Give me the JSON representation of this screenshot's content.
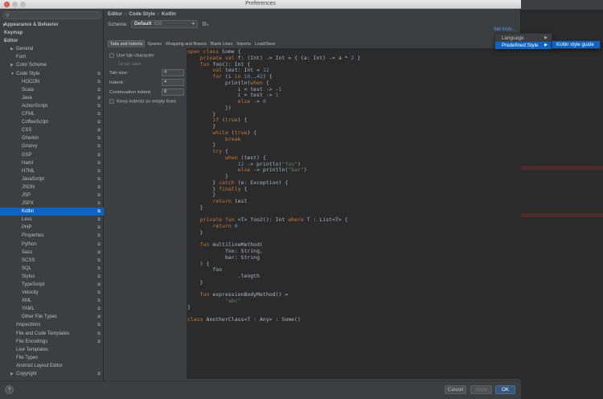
{
  "window": {
    "title": "Preferences"
  },
  "sidebar": {
    "items": [
      {
        "label": "Appearance & Behavior",
        "level": 0,
        "expand": "right",
        "bold": true,
        "copy": false,
        "selected": false
      },
      {
        "label": "Keymap",
        "level": 0,
        "expand": "",
        "bold": true,
        "copy": false,
        "selected": false
      },
      {
        "label": "Editor",
        "level": 0,
        "expand": "down",
        "bold": true,
        "copy": false,
        "selected": false
      },
      {
        "label": "General",
        "level": 1,
        "expand": "right",
        "bold": false,
        "copy": false,
        "selected": false
      },
      {
        "label": "Font",
        "level": 1,
        "expand": "",
        "bold": false,
        "copy": false,
        "selected": false
      },
      {
        "label": "Color Scheme",
        "level": 1,
        "expand": "right",
        "bold": false,
        "copy": false,
        "selected": false
      },
      {
        "label": "Code Style",
        "level": 1,
        "expand": "down",
        "bold": false,
        "copy": true,
        "selected": false
      },
      {
        "label": "HOCON",
        "level": 2,
        "expand": "",
        "bold": false,
        "copy": true,
        "selected": false
      },
      {
        "label": "Scala",
        "level": 2,
        "expand": "",
        "bold": false,
        "copy": true,
        "selected": false
      },
      {
        "label": "Java",
        "level": 2,
        "expand": "",
        "bold": false,
        "copy": true,
        "selected": false
      },
      {
        "label": "ActionScript",
        "level": 2,
        "expand": "",
        "bold": false,
        "copy": true,
        "selected": false
      },
      {
        "label": "CFML",
        "level": 2,
        "expand": "",
        "bold": false,
        "copy": true,
        "selected": false
      },
      {
        "label": "CoffeeScript",
        "level": 2,
        "expand": "",
        "bold": false,
        "copy": true,
        "selected": false
      },
      {
        "label": "CSS",
        "level": 2,
        "expand": "",
        "bold": false,
        "copy": true,
        "selected": false
      },
      {
        "label": "Gherkin",
        "level": 2,
        "expand": "",
        "bold": false,
        "copy": true,
        "selected": false
      },
      {
        "label": "Groovy",
        "level": 2,
        "expand": "",
        "bold": false,
        "copy": true,
        "selected": false
      },
      {
        "label": "GSP",
        "level": 2,
        "expand": "",
        "bold": false,
        "copy": true,
        "selected": false
      },
      {
        "label": "Haml",
        "level": 2,
        "expand": "",
        "bold": false,
        "copy": true,
        "selected": false
      },
      {
        "label": "HTML",
        "level": 2,
        "expand": "",
        "bold": false,
        "copy": true,
        "selected": false
      },
      {
        "label": "JavaScript",
        "level": 2,
        "expand": "",
        "bold": false,
        "copy": true,
        "selected": false
      },
      {
        "label": "JSON",
        "level": 2,
        "expand": "",
        "bold": false,
        "copy": true,
        "selected": false
      },
      {
        "label": "JSP",
        "level": 2,
        "expand": "",
        "bold": false,
        "copy": true,
        "selected": false
      },
      {
        "label": "JSPX",
        "level": 2,
        "expand": "",
        "bold": false,
        "copy": true,
        "selected": false
      },
      {
        "label": "Kotlin",
        "level": 2,
        "expand": "",
        "bold": false,
        "copy": true,
        "selected": true
      },
      {
        "label": "Less",
        "level": 2,
        "expand": "",
        "bold": false,
        "copy": true,
        "selected": false
      },
      {
        "label": "PHP",
        "level": 2,
        "expand": "",
        "bold": false,
        "copy": true,
        "selected": false
      },
      {
        "label": "Properties",
        "level": 2,
        "expand": "",
        "bold": false,
        "copy": true,
        "selected": false
      },
      {
        "label": "Python",
        "level": 2,
        "expand": "",
        "bold": false,
        "copy": true,
        "selected": false
      },
      {
        "label": "Sass",
        "level": 2,
        "expand": "",
        "bold": false,
        "copy": true,
        "selected": false
      },
      {
        "label": "SCSS",
        "level": 2,
        "expand": "",
        "bold": false,
        "copy": true,
        "selected": false
      },
      {
        "label": "SQL",
        "level": 2,
        "expand": "",
        "bold": false,
        "copy": true,
        "selected": false
      },
      {
        "label": "Stylus",
        "level": 2,
        "expand": "",
        "bold": false,
        "copy": true,
        "selected": false
      },
      {
        "label": "TypeScript",
        "level": 2,
        "expand": "",
        "bold": false,
        "copy": true,
        "selected": false
      },
      {
        "label": "Velocity",
        "level": 2,
        "expand": "",
        "bold": false,
        "copy": true,
        "selected": false
      },
      {
        "label": "XML",
        "level": 2,
        "expand": "",
        "bold": false,
        "copy": true,
        "selected": false
      },
      {
        "label": "YAML",
        "level": 2,
        "expand": "",
        "bold": false,
        "copy": true,
        "selected": false
      },
      {
        "label": "Other File Types",
        "level": 2,
        "expand": "",
        "bold": false,
        "copy": true,
        "selected": false
      },
      {
        "label": "Inspections",
        "level": 1,
        "expand": "",
        "bold": false,
        "copy": true,
        "selected": false
      },
      {
        "label": "File and Code Templates",
        "level": 1,
        "expand": "",
        "bold": false,
        "copy": true,
        "selected": false
      },
      {
        "label": "File Encodings",
        "level": 1,
        "expand": "",
        "bold": false,
        "copy": true,
        "selected": false
      },
      {
        "label": "Live Templates",
        "level": 1,
        "expand": "",
        "bold": false,
        "copy": false,
        "selected": false
      },
      {
        "label": "File Types",
        "level": 1,
        "expand": "",
        "bold": false,
        "copy": false,
        "selected": false
      },
      {
        "label": "Android Layout Editor",
        "level": 1,
        "expand": "",
        "bold": false,
        "copy": false,
        "selected": false
      },
      {
        "label": "Copyright",
        "level": 1,
        "expand": "right",
        "bold": false,
        "copy": true,
        "selected": false
      }
    ]
  },
  "breadcrumb": [
    "Editor",
    "Code Style",
    "Kotlin"
  ],
  "scheme": {
    "label": "Scheme:",
    "value": "Default",
    "suffix": "IDE"
  },
  "set_from": "Set from...",
  "tabs": [
    "Tabs and Indents",
    "Spaces",
    "Wrapping and Braces",
    "Blank Lines",
    "Imports",
    "Load/Save"
  ],
  "active_tab": 0,
  "options": {
    "use_tab": "Use tab character",
    "smart_tabs": "Smart tabs",
    "tab_size_label": "Tab size:",
    "tab_size": "4",
    "indent_label": "Indent:",
    "indent": "4",
    "continuation_label": "Continuation indent:",
    "continuation": "8",
    "keep_indents": "Keep indents on empty lines"
  },
  "code_lines": [
    [
      [
        "k",
        "open class "
      ],
      [
        "p",
        "Some {"
      ]
    ],
    [
      [
        "p",
        "    "
      ],
      [
        "k",
        "private val "
      ],
      [
        "p",
        "f: (Int) -> Int = { (a: Int) -> a * "
      ],
      [
        "n",
        "2"
      ],
      [
        "p",
        " }"
      ]
    ],
    [
      [
        "p",
        "    "
      ],
      [
        "k",
        "fun "
      ],
      [
        "p",
        "foo(): Int {"
      ]
    ],
    [
      [
        "p",
        "        "
      ],
      [
        "k",
        "val "
      ],
      [
        "p",
        "test: Int = "
      ],
      [
        "n",
        "12"
      ]
    ],
    [
      [
        "p",
        "        "
      ],
      [
        "k",
        "for "
      ],
      [
        "p",
        "(i "
      ],
      [
        "k",
        "in "
      ],
      [
        "n",
        "10"
      ],
      [
        "p",
        ".."
      ],
      [
        "n",
        "42"
      ],
      [
        "p",
        ") {"
      ]
    ],
    [
      [
        "p",
        "            println("
      ],
      [
        "k",
        "when "
      ],
      [
        "p",
        "{"
      ]
    ],
    [
      [
        "p",
        "                i < test -> -"
      ],
      [
        "n",
        "1"
      ]
    ],
    [
      [
        "p",
        "                i > test -> "
      ],
      [
        "n",
        "1"
      ]
    ],
    [
      [
        "p",
        "                "
      ],
      [
        "k",
        "else "
      ],
      [
        "p",
        "-> "
      ],
      [
        "n",
        "0"
      ]
    ],
    [
      [
        "p",
        "            })"
      ]
    ],
    [
      [
        "p",
        "        }"
      ]
    ],
    [
      [
        "p",
        "        "
      ],
      [
        "k",
        "if "
      ],
      [
        "p",
        "("
      ],
      [
        "k",
        "true"
      ],
      [
        "p",
        ") {"
      ]
    ],
    [
      [
        "p",
        "        }"
      ]
    ],
    [
      [
        "p",
        "        "
      ],
      [
        "k",
        "while "
      ],
      [
        "p",
        "("
      ],
      [
        "k",
        "true"
      ],
      [
        "p",
        ") {"
      ]
    ],
    [
      [
        "p",
        "            "
      ],
      [
        "k",
        "break"
      ]
    ],
    [
      [
        "p",
        "        }"
      ]
    ],
    [
      [
        "p",
        "        "
      ],
      [
        "k",
        "try "
      ],
      [
        "p",
        "{"
      ]
    ],
    [
      [
        "p",
        "            "
      ],
      [
        "k",
        "when "
      ],
      [
        "p",
        "(test) {"
      ]
    ],
    [
      [
        "p",
        "                "
      ],
      [
        "n",
        "12"
      ],
      [
        "p",
        " -> println("
      ],
      [
        "s",
        "\"foo\""
      ],
      [
        "p",
        ")"
      ]
    ],
    [
      [
        "p",
        "                "
      ],
      [
        "k",
        "else "
      ],
      [
        "p",
        "-> println("
      ],
      [
        "s",
        "\"bar\""
      ],
      [
        "p",
        ")"
      ]
    ],
    [
      [
        "p",
        "            }"
      ]
    ],
    [
      [
        "p",
        "        } "
      ],
      [
        "k",
        "catch "
      ],
      [
        "p",
        "(e: Exception) {"
      ]
    ],
    [
      [
        "p",
        "        } "
      ],
      [
        "k",
        "finally "
      ],
      [
        "p",
        "{"
      ]
    ],
    [
      [
        "p",
        "        }"
      ]
    ],
    [
      [
        "p",
        "        "
      ],
      [
        "k",
        "return "
      ],
      [
        "p",
        "test"
      ]
    ],
    [
      [
        "p",
        "    }"
      ]
    ],
    [
      [
        "p",
        ""
      ]
    ],
    [
      [
        "p",
        "    "
      ],
      [
        "k",
        "private fun "
      ],
      [
        "p",
        "<T> foo2(): Int "
      ],
      [
        "k",
        "where "
      ],
      [
        "p",
        "T : List<T> {"
      ]
    ],
    [
      [
        "p",
        "        "
      ],
      [
        "k",
        "return "
      ],
      [
        "n",
        "0"
      ]
    ],
    [
      [
        "p",
        "    }"
      ]
    ],
    [
      [
        "p",
        ""
      ]
    ],
    [
      [
        "p",
        "    "
      ],
      [
        "k",
        "fun "
      ],
      [
        "p",
        "multilineMethod("
      ]
    ],
    [
      [
        "p",
        "            foo: String,"
      ]
    ],
    [
      [
        "p",
        "            bar: String"
      ]
    ],
    [
      [
        "p",
        "    ) {"
      ]
    ],
    [
      [
        "p",
        "        foo"
      ]
    ],
    [
      [
        "p",
        "                .length"
      ]
    ],
    [
      [
        "p",
        "    }"
      ]
    ],
    [
      [
        "p",
        ""
      ]
    ],
    [
      [
        "p",
        "    "
      ],
      [
        "k",
        "fun "
      ],
      [
        "p",
        "expressionBodyMethod() ="
      ]
    ],
    [
      [
        "p",
        "            "
      ],
      [
        "s",
        "\"abc\""
      ]
    ],
    [
      [
        "p",
        "}"
      ]
    ],
    [
      [
        "p",
        ""
      ]
    ],
    [
      [
        "k",
        "class "
      ],
      [
        "p",
        "AnotherClass<T : Any> : Some()"
      ]
    ]
  ],
  "popup": {
    "items": [
      "Language",
      "Predefined Style"
    ],
    "submenu": "Kotlin style guide"
  },
  "footer": {
    "help": "?",
    "cancel": "Cancel",
    "apply": "Apply",
    "ok": "OK"
  },
  "colors": {
    "accent": "#0d64c7",
    "keyword": "#cc7832",
    "number": "#6897bb",
    "string": "#6a8759",
    "text": "#a9b7c6"
  }
}
